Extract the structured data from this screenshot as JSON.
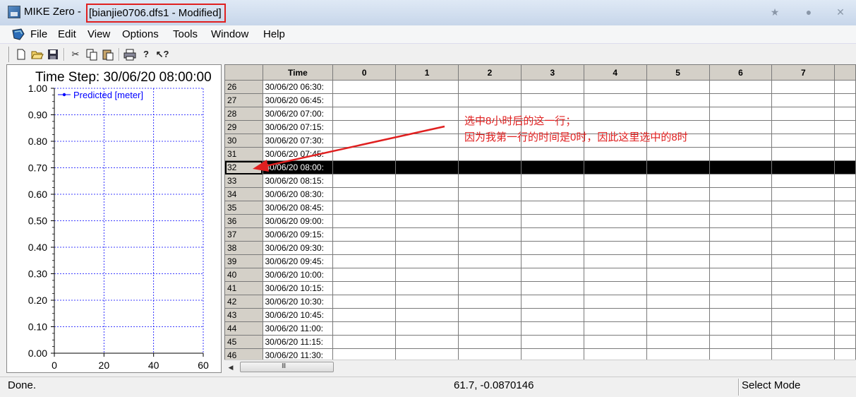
{
  "window": {
    "app_title": "MIKE Zero - ",
    "doc_title": "[bianjie0706.dfs1 - Modified]"
  },
  "menu": {
    "items": [
      "File",
      "Edit",
      "View",
      "Options",
      "Tools",
      "Window",
      "Help"
    ]
  },
  "toolbar": {
    "icons": [
      "new-file-icon",
      "open-folder-icon",
      "save-icon",
      "cut-icon",
      "copy-icon",
      "paste-icon",
      "print-icon",
      "help-icon",
      "context-help-icon"
    ]
  },
  "chart_data": {
    "type": "line",
    "title": "Time Step: 30/06/20 08:00:00",
    "series": [
      {
        "name": "Predicted [meter]",
        "values": []
      }
    ],
    "xlim": [
      0,
      60
    ],
    "ylim": [
      0.0,
      1.0
    ],
    "xticks": [
      "0",
      "20",
      "40",
      "60"
    ],
    "yticks": [
      "0.00",
      "0.10",
      "0.20",
      "0.30",
      "0.40",
      "0.50",
      "0.60",
      "0.70",
      "0.80",
      "0.90",
      "1.00"
    ],
    "grid": true,
    "legend_position": "top-left",
    "series_color": "#0000ff"
  },
  "grid": {
    "headers": [
      "",
      "Time",
      "0",
      "1",
      "2",
      "3",
      "4",
      "5",
      "6",
      "7"
    ],
    "selected_row": "32",
    "rows": [
      [
        "26",
        "30/06/20 06:30:"
      ],
      [
        "27",
        "30/06/20 06:45:"
      ],
      [
        "28",
        "30/06/20 07:00:"
      ],
      [
        "29",
        "30/06/20 07:15:"
      ],
      [
        "30",
        "30/06/20 07:30:"
      ],
      [
        "31",
        "30/06/20 07:45:"
      ],
      [
        "32",
        "30/06/20 08:00:"
      ],
      [
        "33",
        "30/06/20 08:15:"
      ],
      [
        "34",
        "30/06/20 08:30:"
      ],
      [
        "35",
        "30/06/20 08:45:"
      ],
      [
        "36",
        "30/06/20 09:00:"
      ],
      [
        "37",
        "30/06/20 09:15:"
      ],
      [
        "38",
        "30/06/20 09:30:"
      ],
      [
        "39",
        "30/06/20 09:45:"
      ],
      [
        "40",
        "30/06/20 10:00:"
      ],
      [
        "41",
        "30/06/20 10:15:"
      ],
      [
        "42",
        "30/06/20 10:30:"
      ],
      [
        "43",
        "30/06/20 10:45:"
      ],
      [
        "44",
        "30/06/20 11:00:"
      ],
      [
        "45",
        "30/06/20 11:15:"
      ],
      [
        "46",
        "30/06/20 11:30:"
      ]
    ]
  },
  "scrollbar": {
    "grip": "III"
  },
  "annotation": {
    "line1": "选中8小时后的这一行；",
    "line2": "因为我第一行的时间是0时，因此这里选中的8时",
    "color": "#e02020"
  },
  "status": {
    "left": "Done.",
    "coords": "61.7, -0.0870146",
    "mode": "Select Mode"
  }
}
